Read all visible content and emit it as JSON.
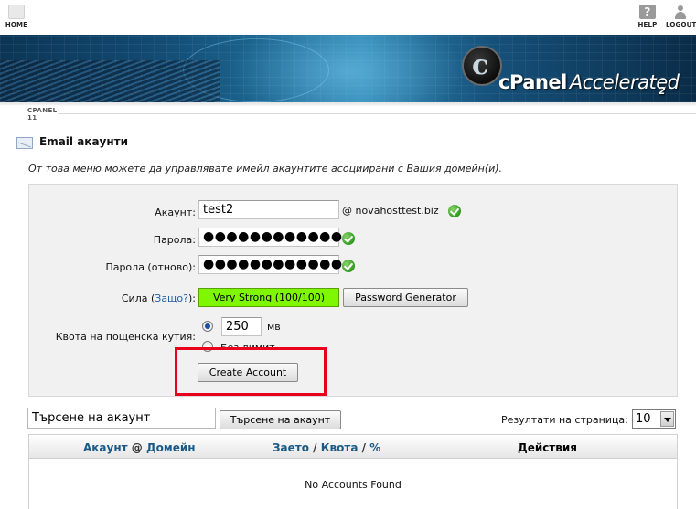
{
  "nav": {
    "home": "HOME",
    "help": "HELP",
    "help_glyph": "?",
    "logout": "LOGOUT"
  },
  "brand": {
    "logo_letter": "c",
    "name_c": "cPanel",
    "name_acc": "Accelerated",
    "name_sub": "2",
    "version": "CPANEL 11"
  },
  "page": {
    "title": "Email акаунти",
    "intro": "От това меню можете да управлявате имейл акаунтите асоциирани с Вашия домейн(и)."
  },
  "form": {
    "account_label": "Акаунт:",
    "account_value": "test2",
    "domain": "@ novahosttest.biz",
    "password_label": "Парола:",
    "password_value": "●●●●●●●●●●●●",
    "password_again_label": "Парола (отново):",
    "password_again_value": "●●●●●●●●●●●●",
    "strength_label": "Сила (",
    "strength_why": "Защо?",
    "strength_suffix": "):",
    "strength_value": "Very Strong (100/100)",
    "password_generator": "Password Generator",
    "quota_label": "Квота на пощенска кутия:",
    "quota_value": "250",
    "quota_unit": "мв",
    "quota_unlimited": "Без лимит",
    "quota_selected": "limited",
    "create_button": "Create Account",
    "highlight_color": "#e8001c",
    "strength_color": "#7ef700"
  },
  "search": {
    "input_value": "Търсене на акаунт",
    "button": "Търсене на акаунт",
    "per_page_label": "Резултати на страница:",
    "per_page_value": "10"
  },
  "table": {
    "col_account": "Акаунт",
    "col_at": "@",
    "col_domain": "Домейн",
    "col_used": "Заето",
    "col_slash": "/",
    "col_quota": "Квота",
    "col_pct": "%",
    "col_actions": "Действия",
    "empty": "No Accounts Found"
  }
}
